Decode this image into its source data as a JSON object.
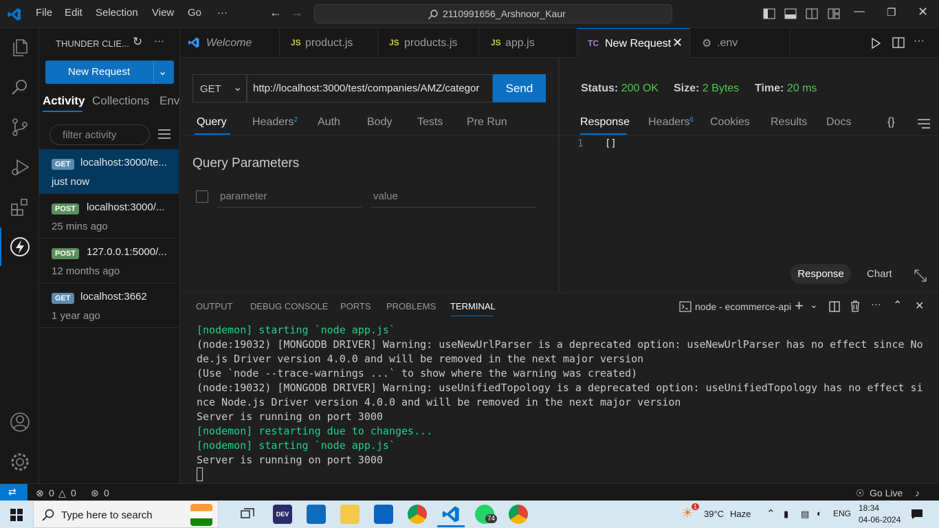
{
  "titlebar": {
    "menu": [
      "File",
      "Edit",
      "Selection",
      "View",
      "Go",
      "···"
    ],
    "search": "2110991656_Arshnoor_Kaur"
  },
  "sidebar": {
    "title": "THUNDER CLIE...",
    "new_request": "New Request",
    "tabs": [
      "Activity",
      "Collections",
      "Env"
    ],
    "filter_placeholder": "filter activity",
    "activity": [
      {
        "method": "GET",
        "url": "localhost:3000/te...",
        "time": "just now"
      },
      {
        "method": "POST",
        "url": "localhost:3000/...",
        "time": "25 mins ago"
      },
      {
        "method": "POST",
        "url": "127.0.0.1:5000/...",
        "time": "12 months ago"
      },
      {
        "method": "GET",
        "url": "localhost:3662",
        "time": "1 year ago"
      }
    ]
  },
  "tabs": {
    "welcome": "Welcome",
    "product": "product.js",
    "products": "products.js",
    "app": "app.js",
    "new_request": "New Request",
    "env": ".env",
    "js_badge": "JS",
    "tc_badge": "TC"
  },
  "request": {
    "method": "GET",
    "url": "http://localhost:3000/test/companies/AMZ/categor",
    "send": "Send",
    "tabs": {
      "query": "Query",
      "headers": "Headers",
      "headers_count": "2",
      "auth": "Auth",
      "body": "Body",
      "tests": "Tests",
      "prerun": "Pre Run"
    },
    "query_title": "Query Parameters",
    "param_placeholder": "parameter",
    "value_placeholder": "value"
  },
  "response": {
    "status_label": "Status:",
    "status": "200 OK",
    "size_label": "Size:",
    "size": "2 Bytes",
    "time_label": "Time:",
    "time": "20 ms",
    "tabs": {
      "response": "Response",
      "headers": "Headers",
      "headers_count": "6",
      "cookies": "Cookies",
      "results": "Results",
      "docs": "Docs",
      "braces": "{}"
    },
    "line_no": "1",
    "body": "[]",
    "view_response": "Response",
    "view_chart": "Chart"
  },
  "panel": {
    "tabs": [
      "OUTPUT",
      "DEBUG CONSOLE",
      "PORTS",
      "PROBLEMS",
      "TERMINAL"
    ],
    "terminal_name": "node - ecommerce-api",
    "lines": [
      "[nodemon] starting `node app.js`",
      "(node:19032) [MONGODB DRIVER] Warning: useNewUrlParser is a deprecated option: useNewUrlParser has no effect since No",
      "de.js Driver version 4.0.0 and will be removed in the next major version",
      "(Use `node --trace-warnings ...` to show where the warning was created)",
      "(node:19032) [MONGODB DRIVER] Warning: useUnifiedTopology is a deprecated option: useUnifiedTopology has no effect si",
      "nce Node.js Driver version 4.0.0 and will be removed in the next major version",
      "Server is running on port 3000",
      "[nodemon] restarting due to changes...",
      "[nodemon] starting `node app.js`",
      "Server is running on port 3000"
    ]
  },
  "statusbar": {
    "errors": "0",
    "warnings": "0",
    "ports": "0",
    "golive": "Go Live"
  },
  "taskbar": {
    "search": "Type here to search",
    "weather_temp": "39°C",
    "weather_text": "Haze",
    "weather_badge": "1",
    "lang": "ENG",
    "time": "18:34",
    "date": "04-06-2024",
    "whatsapp_badge": "74",
    "dev_label": "DEV"
  },
  "colors": {
    "accent": "#0078d4",
    "success": "#4ec94e",
    "terminal_green": "#23d18b"
  }
}
